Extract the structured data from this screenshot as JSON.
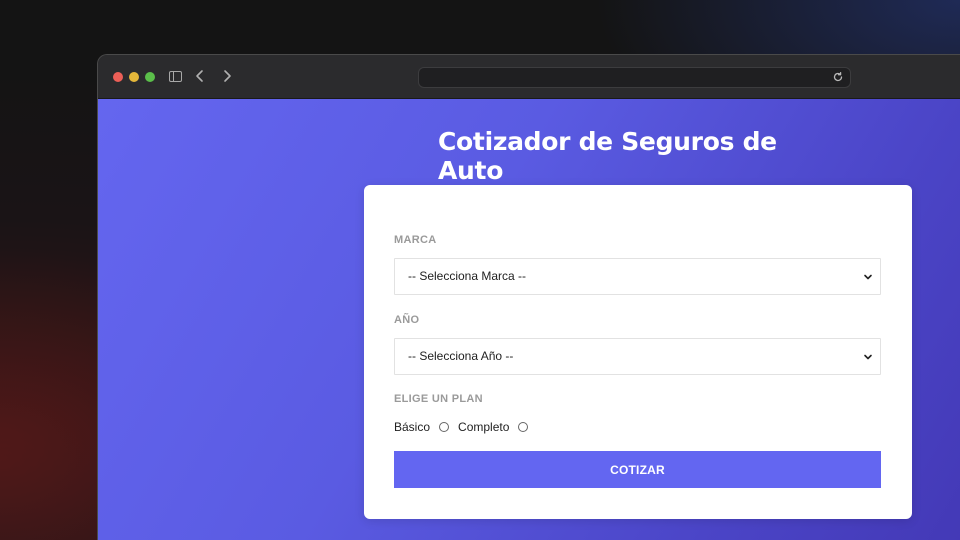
{
  "browser": {
    "url": ""
  },
  "page": {
    "title": "Cotizador de Seguros de Auto"
  },
  "form": {
    "marca": {
      "label": "MARCA",
      "selected": "-- Selecciona Marca --"
    },
    "anio": {
      "label": "AÑO",
      "selected": "-- Selecciona Año --"
    },
    "plan": {
      "label": "ELIGE UN PLAN",
      "options": [
        "Básico",
        "Completo"
      ]
    },
    "submit_label": "COTIZAR"
  },
  "colors": {
    "accent": "#6366f1",
    "background_start": "#6466ef",
    "background_end": "#4338b5"
  },
  "icons": {
    "sidebar": "sidebar-icon",
    "back": "chevron-left-icon",
    "forward": "chevron-right-icon",
    "reload": "reload-icon",
    "dropdown": "chevron-down-icon"
  }
}
